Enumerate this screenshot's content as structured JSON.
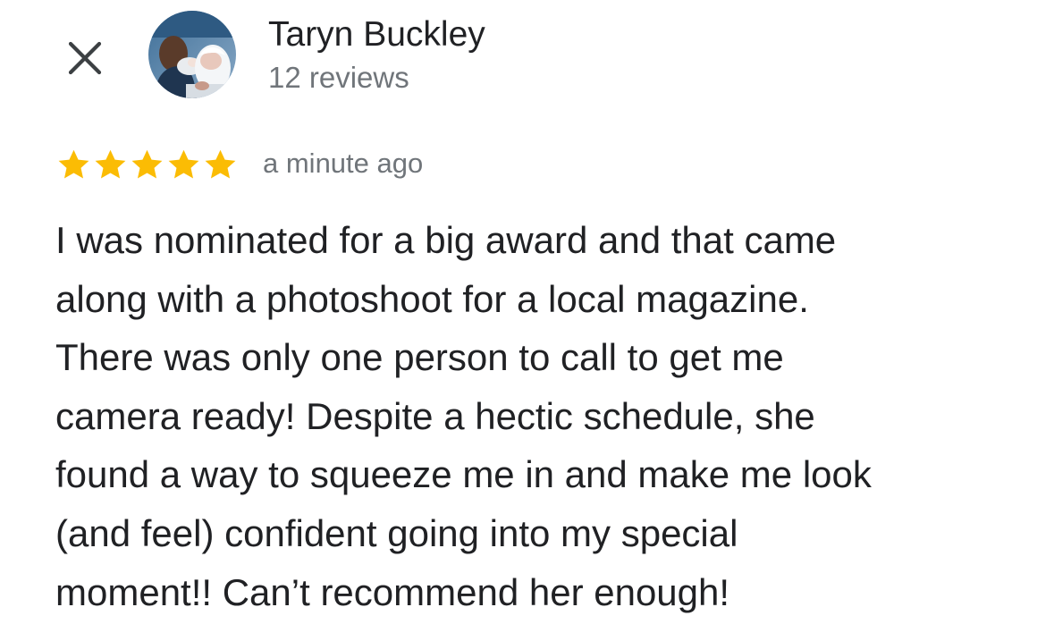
{
  "header": {
    "close_icon": "close-icon",
    "reviewer_name": "Taryn Buckley",
    "review_count": "12 reviews",
    "avatar_icon": "avatar-photo"
  },
  "review": {
    "rating": 5,
    "rating_max": 5,
    "star_color": "#fbbc04",
    "timestamp": "a minute ago",
    "text_lines": [
      "I was nominated for a big award and that came",
      "along with a photoshoot for a local magazine.",
      "There was only one person to call to get me",
      "camera ready! Despite a hectic schedule, she",
      "found a way to squeeze me in and make me look",
      "(and feel) confident going into my special",
      "moment!! Can’t recommend her enough!"
    ]
  },
  "colors": {
    "primary_text": "#202124",
    "secondary_text": "#70757a",
    "star": "#fbbc04",
    "background": "#ffffff"
  }
}
